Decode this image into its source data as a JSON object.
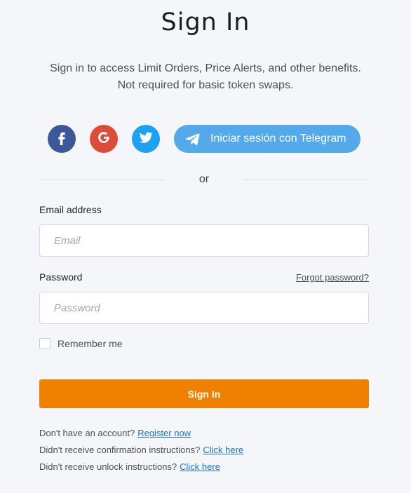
{
  "page": {
    "title": "Sign In",
    "subtitle_line1": "Sign in to access Limit Orders, Price Alerts, and other benefits.",
    "subtitle_line2": "Not required for basic token swaps."
  },
  "social": {
    "facebook_icon": "facebook-icon",
    "google_icon": "google-icon",
    "twitter_icon": "twitter-icon",
    "telegram_label": "Iniciar sesión con Telegram",
    "colors": {
      "facebook": "#3b5998",
      "google": "#dd4b39",
      "twitter": "#1da1f2",
      "telegram": "#54a9eb"
    }
  },
  "divider": {
    "text": "or"
  },
  "form": {
    "email_label": "Email address",
    "email_placeholder": "Email",
    "password_label": "Password",
    "forgot_password": "Forgot password?",
    "password_placeholder": "Password",
    "remember_me": "Remember me",
    "remember_checked": false,
    "submit_label": "Sign In",
    "accent_color": "#f08100"
  },
  "footer": {
    "account_prompt": "Don't have an account?",
    "register_link": "Register now",
    "confirmation_prompt": "Didn't receive confirmation instructions?",
    "confirmation_link": "Click here",
    "unlock_prompt": "Didn't receive unlock instructions?",
    "unlock_link": "Click here"
  }
}
